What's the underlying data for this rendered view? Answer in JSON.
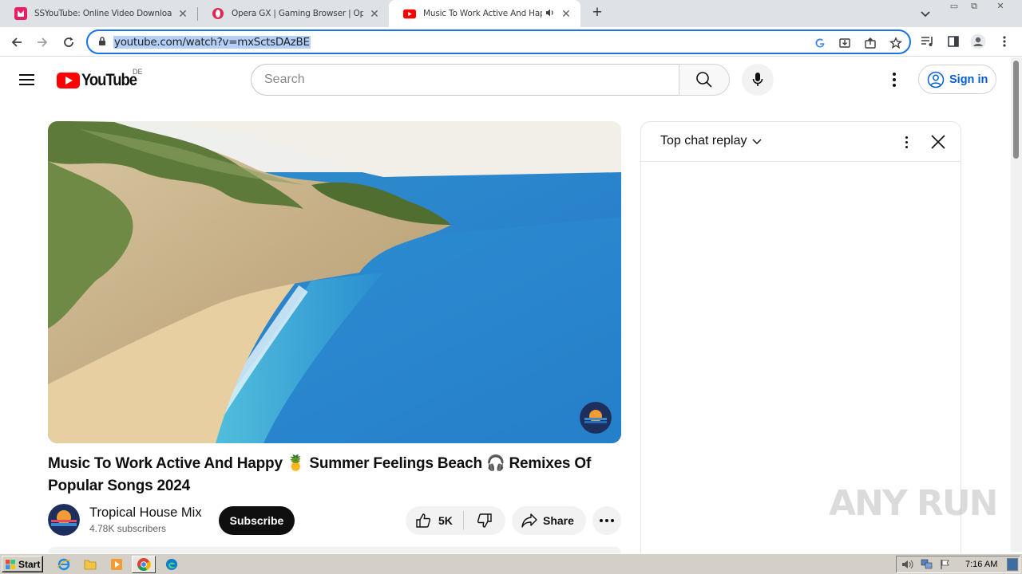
{
  "browser": {
    "tabs": [
      {
        "title": "SSYouTube: Online Video Downloader",
        "active": false
      },
      {
        "title": "Opera GX | Gaming Browser | Opera",
        "active": false
      },
      {
        "title": "Music To Work Active And Happy",
        "active": true
      }
    ],
    "url": "youtube.com/watch?v=mxSctsDAzBE"
  },
  "youtube": {
    "logo_text": "YouTube",
    "country_code": "DE",
    "search_placeholder": "Search",
    "sign_in_label": "Sign in",
    "video": {
      "title": "Music To Work Active And Happy 🍍 Summer Feelings Beach 🎧 Remixes Of Popular Songs 2024",
      "channel_name": "Tropical House Mix",
      "subscribers": "4.78K subscribers",
      "subscribe_label": "Subscribe",
      "likes": "5K",
      "share_label": "Share"
    },
    "chat": {
      "title": "Top chat replay"
    }
  },
  "watermark": "ANY RUN",
  "taskbar": {
    "start_label": "Start",
    "clock": "7:16 AM"
  },
  "colors": {
    "accent": "#1a73e8",
    "youtube_red": "#ff0000",
    "link_blue": "#065fd4"
  }
}
